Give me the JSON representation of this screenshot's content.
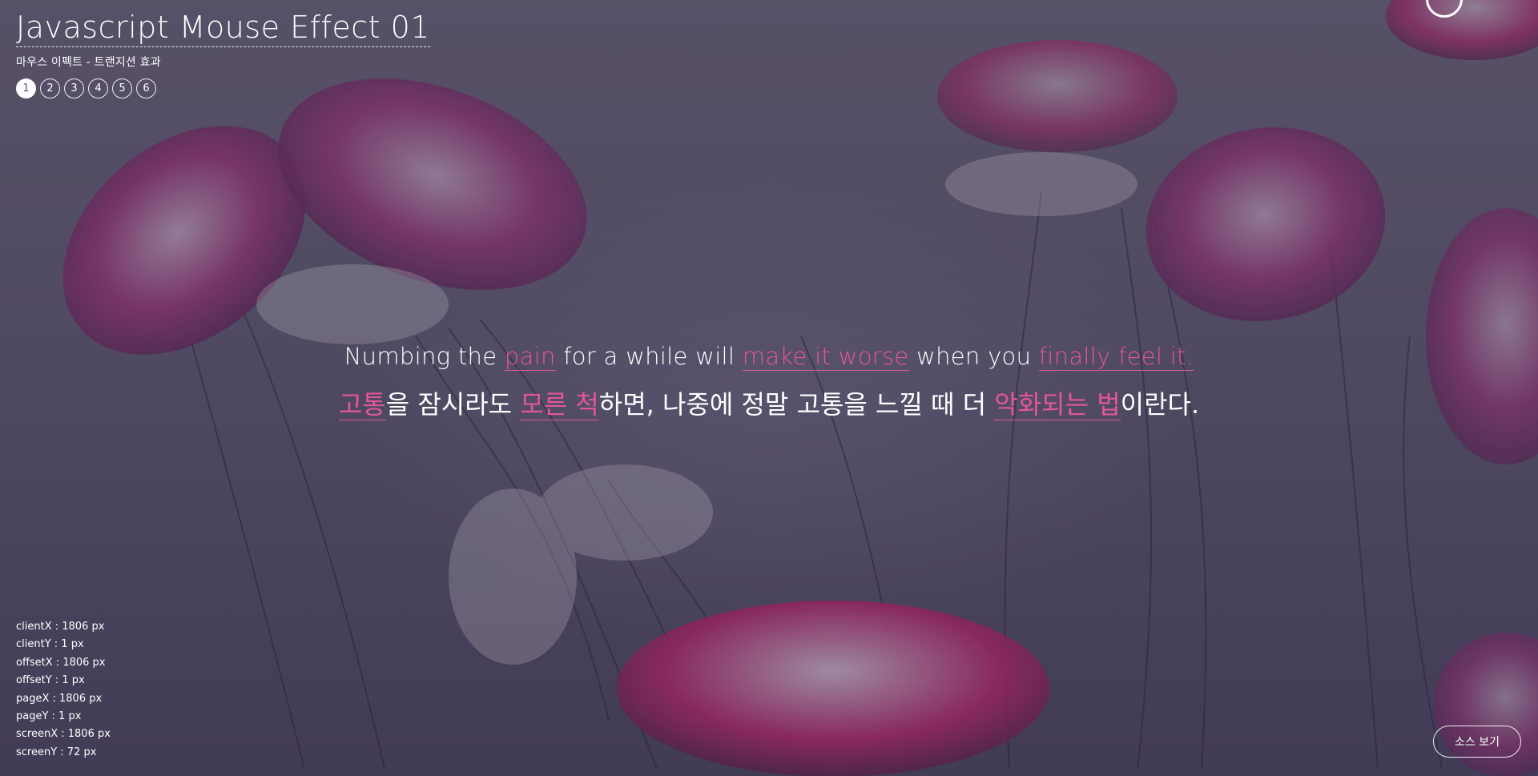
{
  "header": {
    "title": "Javascript Mouse Effect 01",
    "subtitle": "마우스 이펙트 - 트랜지션 효과",
    "pages": [
      "1",
      "2",
      "3",
      "4",
      "5",
      "6"
    ],
    "active_page": "1"
  },
  "quote": {
    "en": {
      "t1": "Numbing the ",
      "h1": "pain",
      "t2": " for a while will ",
      "h2": "make it worse",
      "t3": " when you ",
      "h3": "finally feel it."
    },
    "ko": {
      "h1": "고통",
      "t1": "을 잠시라도 ",
      "h2": "모른 척",
      "t2": "하면, 나중에 정말 고통을 느낄 때 더 ",
      "h3": "악화되는 법",
      "t3": "이란다."
    }
  },
  "mouse_info": [
    "clientX : 1806 px",
    "clientY : 1 px",
    "offsetX : 1806 px",
    "offsetY : 1 px",
    "pageX : 1806 px",
    "pageY : 1 px",
    "screenX : 1806 px",
    "screenY : 72 px"
  ],
  "source_button": "소스 보기",
  "colors": {
    "accent": "#e3569a",
    "background": "#5e586f",
    "text": "#ffffff"
  },
  "icons": {
    "cursor": "cursor-ring-icon"
  }
}
